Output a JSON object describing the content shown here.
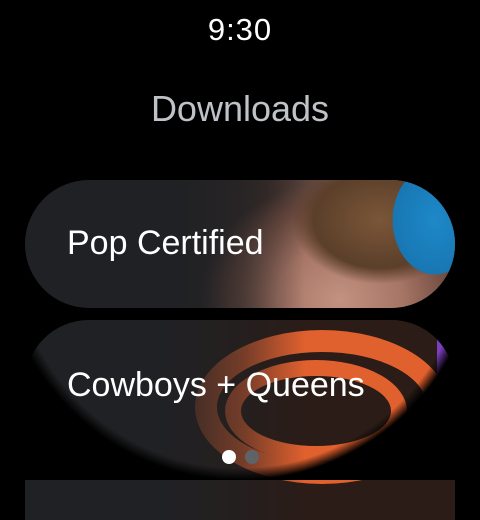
{
  "status": {
    "time": "9:30"
  },
  "header": {
    "title": "Downloads"
  },
  "items": [
    {
      "label": "Pop Certified"
    },
    {
      "label": "Cowboys + Queens"
    }
  ],
  "pager": {
    "pages": 2,
    "active_index": 0
  },
  "colors": {
    "background": "#000000",
    "chip": "#202124",
    "title": "#bfc2c6",
    "dot_active": "#ffffff",
    "dot_inactive": "#5f6368"
  }
}
